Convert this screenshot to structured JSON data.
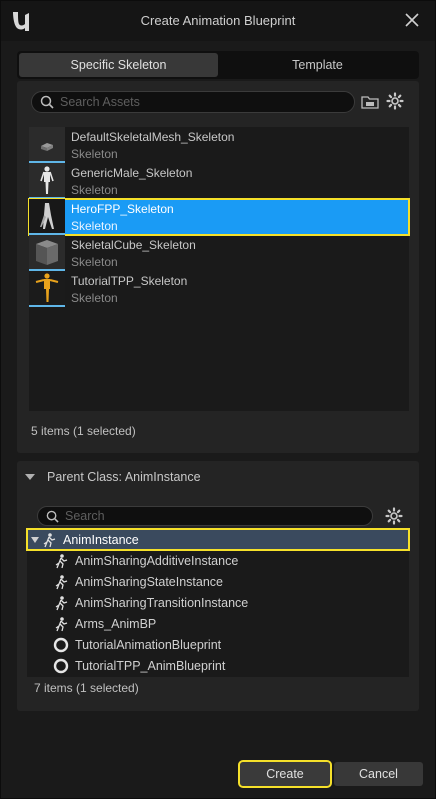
{
  "window": {
    "title": "Create Animation Blueprint"
  },
  "tabs": [
    {
      "label": "Specific Skeleton",
      "active": true
    },
    {
      "label": "Template",
      "active": false
    }
  ],
  "asset_search": {
    "placeholder": "Search Assets",
    "value": ""
  },
  "assets": [
    {
      "name": "DefaultSkeletalMesh_Skeleton",
      "type": "Skeleton",
      "thumb_icon": "cube-mesh-icon",
      "selected": false
    },
    {
      "name": "GenericMale_Skeleton",
      "type": "Skeleton",
      "thumb_icon": "male-figure-icon",
      "selected": false
    },
    {
      "name": "HeroFPP_Skeleton",
      "type": "Skeleton",
      "thumb_icon": "arms-icon",
      "selected": true
    },
    {
      "name": "SkeletalCube_Skeleton",
      "type": "Skeleton",
      "thumb_icon": "cube-icon",
      "selected": false
    },
    {
      "name": "TutorialTPP_Skeleton",
      "type": "Skeleton",
      "thumb_icon": "yellow-figure-icon",
      "selected": false
    }
  ],
  "asset_count": "5 items (1 selected)",
  "parent_class": {
    "header": "Parent Class: AnimInstance",
    "search_placeholder": "Search",
    "items": [
      {
        "label": "AnimInstance",
        "icon": "anim-instance-icon",
        "root": true
      },
      {
        "label": "AnimSharingAdditiveInstance",
        "icon": "anim-instance-icon"
      },
      {
        "label": "AnimSharingStateInstance",
        "icon": "anim-instance-icon"
      },
      {
        "label": "AnimSharingTransitionInstance",
        "icon": "anim-instance-icon"
      },
      {
        "label": "Arms_AnimBP",
        "icon": "anim-instance-icon"
      },
      {
        "label": "TutorialAnimationBlueprint",
        "icon": "blueprint-circle-icon"
      },
      {
        "label": "TutorialTPP_AnimBlueprint",
        "icon": "blueprint-circle-icon"
      }
    ],
    "count": "7 items (1 selected)"
  },
  "buttons": {
    "create": "Create",
    "cancel": "Cancel"
  },
  "colors": {
    "selection": "#1a9bf5",
    "focus_outline": "#f5e02a",
    "root_row": "#3a4a5e"
  }
}
